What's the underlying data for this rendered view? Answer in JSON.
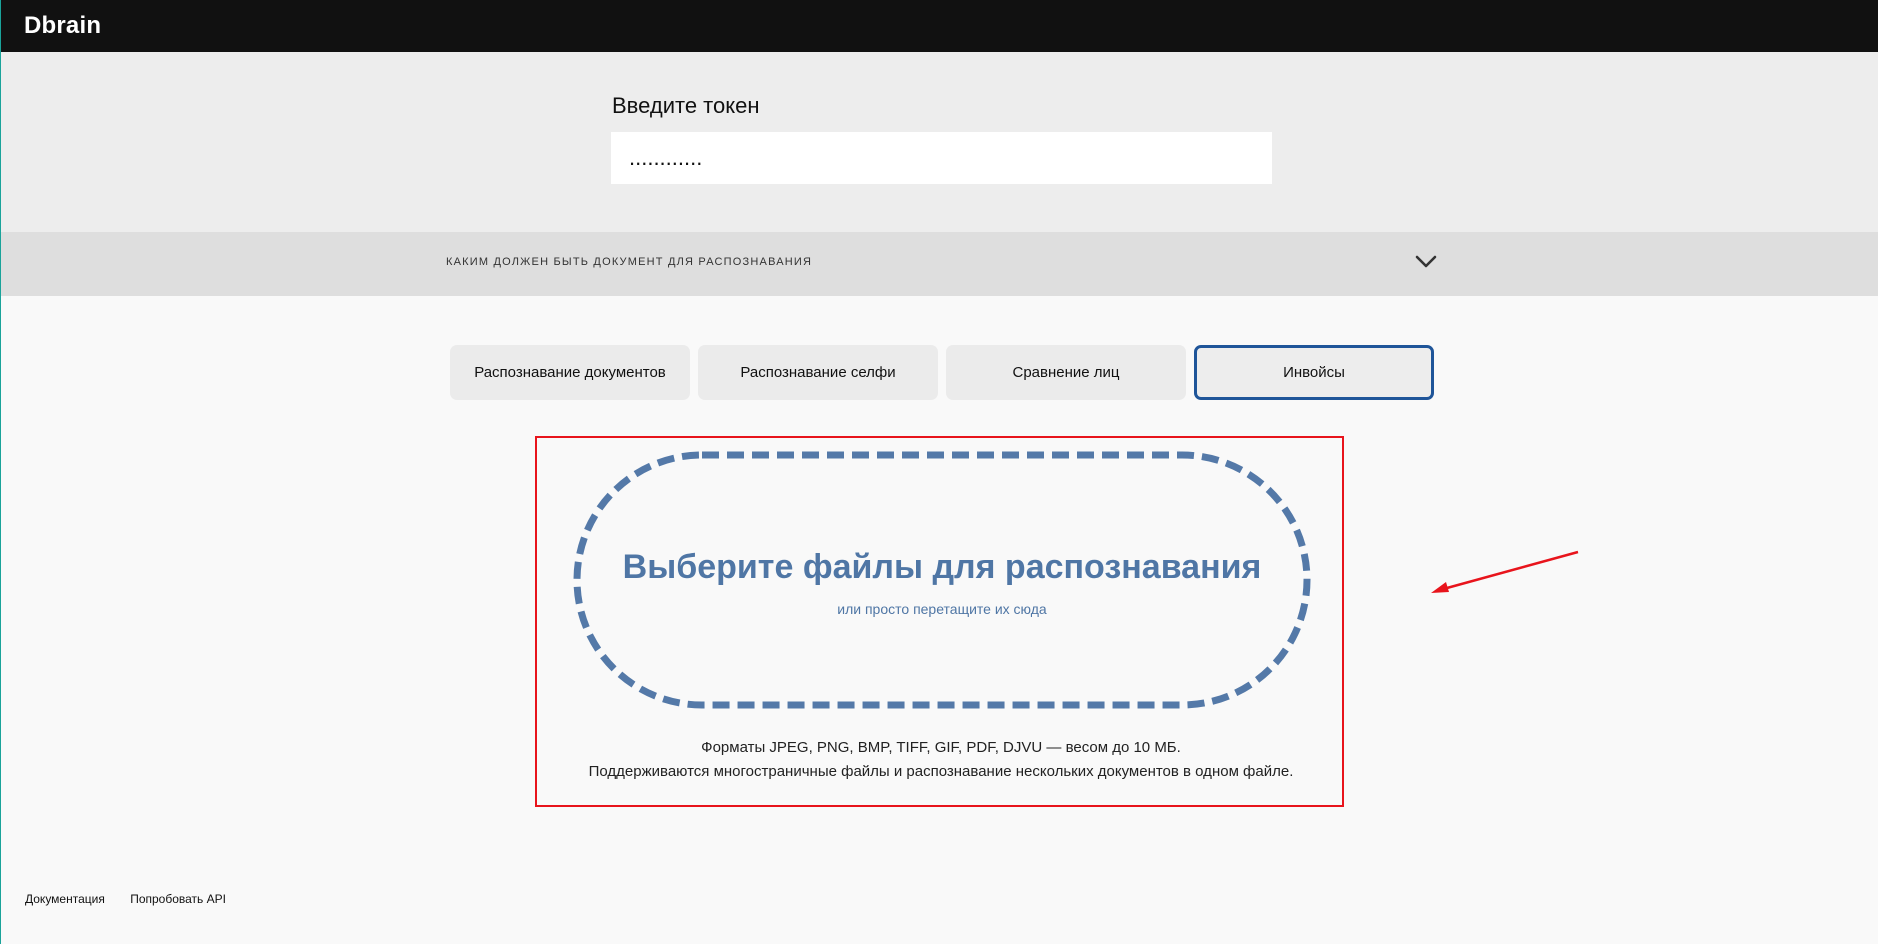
{
  "header": {
    "logo": "Dbrain"
  },
  "token": {
    "label": "Введите токен",
    "value": "............"
  },
  "accordion": {
    "title": "КАКИМ ДОЛЖЕН БЫТЬ ДОКУМЕНТ ДЛЯ РАСПОЗНАВАНИЯ",
    "icon": "chevron-down-icon"
  },
  "tabs": [
    {
      "label": "Распознавание документов",
      "active": false
    },
    {
      "label": "Распознавание селфи",
      "active": false
    },
    {
      "label": "Сравнение лиц",
      "active": false
    },
    {
      "label": "Инвойсы",
      "active": true
    }
  ],
  "dropzone": {
    "title": "Выберите файлы для распознавания",
    "subtitle": "или просто перетащите их сюда"
  },
  "formats": {
    "line1": "Форматы JPEG, PNG, BMP, TIFF, GIF, PDF, DJVU — весом до 10 МБ.",
    "line2": "Поддерживаются многостраничные файлы и распознавание нескольких документов в одном файле."
  },
  "footer": {
    "links": [
      "Документация",
      "Попробовать API"
    ]
  },
  "colors": {
    "accent": "#4f76a5",
    "active_tab_border": "#1f5599",
    "annotation_red": "#e8141c"
  }
}
